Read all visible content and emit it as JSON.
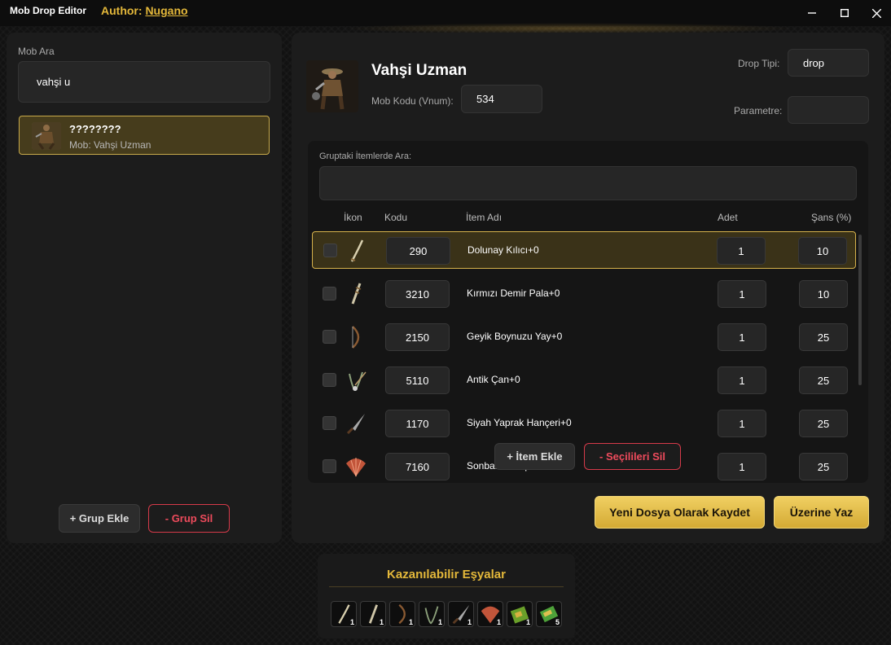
{
  "window": {
    "app_title": "Mob Drop Editor",
    "author_prefix": "Author:",
    "author_name": "Nugano",
    "minimize": "–",
    "maximize": "☐",
    "close": "✕"
  },
  "left": {
    "search_label": "Mob Ara",
    "search_value": "vahşi u",
    "mob_results": [
      {
        "name": "????????",
        "subtitle": "Mob: Vahşi Uzman"
      }
    ],
    "add_group": "+ Grup Ekle",
    "delete_group": "- Grup Sil"
  },
  "mob": {
    "name": "Vahşi Uzman",
    "code_label": "Mob Kodu (Vnum):",
    "code": "534",
    "drop_type_label": "Drop Tipi:",
    "drop_type": "drop",
    "param_label": "Parametre:",
    "param": ""
  },
  "group": {
    "search_label": "Gruptaki İtemlerde Ara:",
    "search_value": "",
    "columns": {
      "icon": "İkon",
      "code": "Kodu",
      "name": "İtem Adı",
      "count": "Adet",
      "chance": "Şans (%)"
    },
    "items": [
      {
        "code": "290",
        "name": "Dolunay Kılıcı+0",
        "count": "1",
        "chance": "10",
        "icon": "sword-icon",
        "selected": true
      },
      {
        "code": "3210",
        "name": "Kırmızı Demir Pala+0",
        "count": "1",
        "chance": "10",
        "icon": "blade-icon",
        "selected": false
      },
      {
        "code": "2150",
        "name": "Geyik Boynuzu Yay+0",
        "count": "1",
        "chance": "25",
        "icon": "bow-icon",
        "selected": false
      },
      {
        "code": "5110",
        "name": "Antik Çan+0",
        "count": "1",
        "chance": "25",
        "icon": "bell-icon",
        "selected": false
      },
      {
        "code": "1170",
        "name": "Siyah Yaprak Hançeri+0",
        "count": "1",
        "chance": "25",
        "icon": "dagger-icon",
        "selected": false
      },
      {
        "code": "7160",
        "name": "Sonbahar Yelpazesi+0",
        "count": "1",
        "chance": "25",
        "icon": "fan-icon",
        "selected": false
      }
    ],
    "add_item": "+ İtem Ekle",
    "delete_selected": "- Seçilileri Sil"
  },
  "actions": {
    "save_new": "Yeni Dosya Olarak Kaydet",
    "overwrite": "Üzerine Yaz"
  },
  "loot": {
    "title": "Kazanılabilir Eşyalar",
    "slots": [
      {
        "icon": "sword-icon",
        "count": "1"
      },
      {
        "icon": "blade-icon",
        "count": "1"
      },
      {
        "icon": "bow-icon",
        "count": "1"
      },
      {
        "icon": "bell-icon",
        "count": "1"
      },
      {
        "icon": "dagger-icon",
        "count": "1"
      },
      {
        "icon": "fan-icon",
        "count": "1"
      },
      {
        "icon": "green-box-icon",
        "count": "1"
      },
      {
        "icon": "green-scroll-icon",
        "count": "5"
      }
    ]
  },
  "colors": {
    "accent_gold": "#e4b83a",
    "danger_red": "#d63a4a",
    "selected_row": "#3a3218"
  }
}
